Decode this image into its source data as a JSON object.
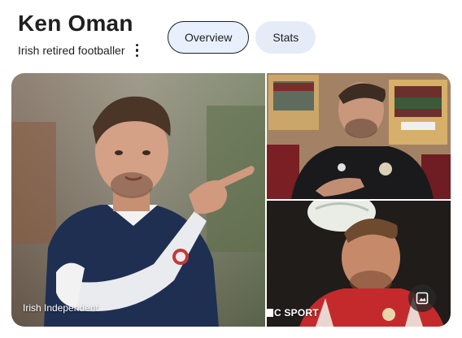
{
  "header": {
    "title": "Ken Oman",
    "subtitle": "Irish retired footballer"
  },
  "tabs": [
    {
      "label": "Overview",
      "active": true
    },
    {
      "label": "Stats",
      "active": false
    }
  ],
  "gallery": {
    "main": {
      "source": "Irish Independent"
    },
    "bottom_right": {
      "source_prefix": "C",
      "source": "SPORT"
    }
  },
  "colors": {
    "active_tab_bg": "#e8f0fe",
    "idle_tab_bg": "#e6ecf7",
    "text": "#1f1f1f"
  },
  "icons": {
    "more": "vertical-dots-icon",
    "images": "image-icon"
  }
}
